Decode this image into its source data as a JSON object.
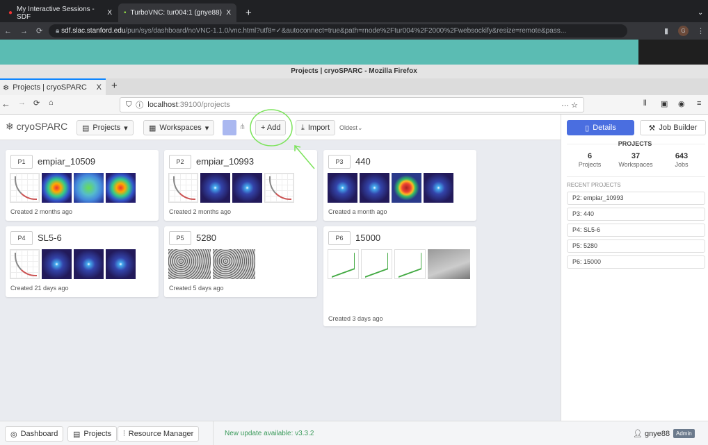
{
  "chrome": {
    "tabs": [
      {
        "label": "My Interactive Sessions - SDF",
        "close": "X"
      },
      {
        "label": "TurboVNC: tur004:1 (gnye88)",
        "close": "X"
      }
    ],
    "new_tab": "+",
    "url_host": "sdf.slac.stanford.edu",
    "url_rest": "/pun/sys/dashboard/noVNC-1.1.0/vnc.html?utf8=✓&autoconnect=true&path=rnode%2Ftur004%2F2000%2Fwebsockify&resize=remote&pass...",
    "profile": "G"
  },
  "firefox": {
    "window_title": "Projects | cryoSPARC - Mozilla Firefox",
    "tab_label": "Projects | cryoSPARC",
    "tab_close": "X",
    "url_host": "localhost",
    "url_rest": ":39100/projects"
  },
  "app": {
    "logo": "cryoSPARC",
    "projects_btn": "Projects",
    "workspaces_btn": "Workspaces",
    "add_btn": "+ Add",
    "import_btn": "Import",
    "sort": "Oldest"
  },
  "projects": [
    {
      "id": "P1",
      "title": "empiar_10509",
      "created": "Created 2 months ago"
    },
    {
      "id": "P2",
      "title": "empiar_10993",
      "created": "Created 2 months ago"
    },
    {
      "id": "P3",
      "title": "440",
      "created": "Created a month ago"
    },
    {
      "id": "P4",
      "title": "SL5-6",
      "created": "Created 21 days ago"
    },
    {
      "id": "P5",
      "title": "5280",
      "created": "Created 5 days ago"
    },
    {
      "id": "P6",
      "title": "15000",
      "created": "Created 3 days ago"
    }
  ],
  "sidebar": {
    "details_btn": "Details",
    "job_builder_btn": "Job Builder",
    "heading": "PROJECTS",
    "stats": [
      {
        "value": "6",
        "label": "Projects"
      },
      {
        "value": "37",
        "label": "Workspaces"
      },
      {
        "value": "643",
        "label": "Jobs"
      }
    ],
    "recent_heading": "RECENT PROJECTS",
    "recent": [
      "P2: empiar_10993",
      "P3: 440",
      "P4: SL5-6",
      "P5: 5280",
      "P6: 15000"
    ],
    "accent": "#4a6ee0"
  },
  "footer": {
    "dashboard": "Dashboard",
    "projects": "Projects",
    "resource_manager": "Resource Manager",
    "update": "New update available: v3.3.2",
    "user": "gnye88",
    "role": "Admin"
  },
  "annotation_color": "#7be35a"
}
